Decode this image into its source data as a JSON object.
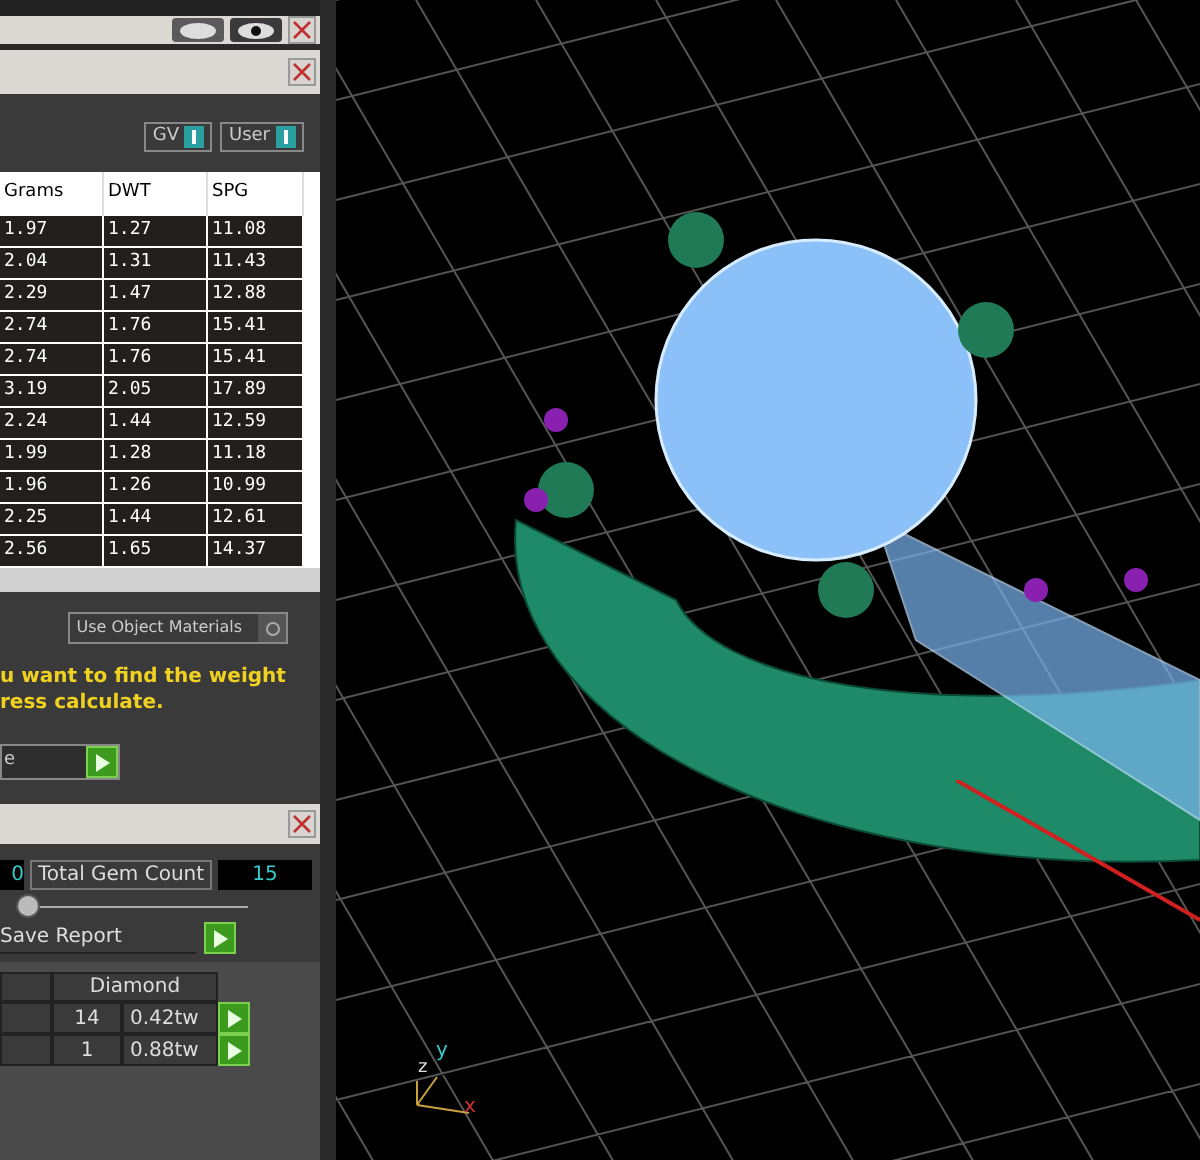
{
  "top_panel": {
    "eye_toggles": [
      {
        "selected": false
      },
      {
        "selected": true
      }
    ]
  },
  "weights_panel": {
    "toggles": [
      {
        "label": "GV",
        "on": true
      },
      {
        "label": "User",
        "on": true
      }
    ],
    "table": {
      "columns": [
        "Grams",
        "DWT",
        "SPG"
      ],
      "rows": [
        [
          "1.97",
          "1.27",
          "11.08"
        ],
        [
          "2.04",
          "1.31",
          "11.43"
        ],
        [
          "2.29",
          "1.47",
          "12.88"
        ],
        [
          "2.74",
          "1.76",
          "15.41"
        ],
        [
          "2.74",
          "1.76",
          "15.41"
        ],
        [
          "3.19",
          "2.05",
          "17.89"
        ],
        [
          "2.24",
          "1.44",
          "12.59"
        ],
        [
          "1.99",
          "1.28",
          "11.18"
        ],
        [
          "1.96",
          "1.26",
          "10.99"
        ],
        [
          "2.25",
          "1.44",
          "12.61"
        ],
        [
          "2.56",
          "1.65",
          "14.37"
        ]
      ]
    },
    "use_object_materials": {
      "label": "Use Object Materials",
      "checked": false
    },
    "hint": [
      "u want to find the weight",
      "ress calculate."
    ],
    "calculate_field": {
      "value": "e"
    }
  },
  "gem_panel": {
    "count_field": "0",
    "total_label": "Total Gem Count",
    "total_value": "15",
    "slider": {
      "level": 0.05
    },
    "save_report": "Save Report",
    "table": {
      "columns": [
        "Diamond"
      ],
      "rows": [
        [
          "14",
          "0.42tw"
        ],
        [
          "1",
          "0.88tw"
        ]
      ]
    }
  },
  "viewport": {
    "axes": [
      "y",
      "z",
      "x"
    ]
  }
}
